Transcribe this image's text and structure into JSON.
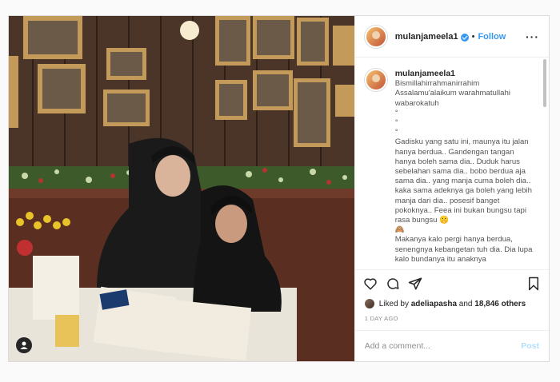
{
  "post": {
    "username": "mulanjameela1",
    "follow_label": "Follow",
    "separator": "•",
    "more_label": "···",
    "caption": "Bismillahirrahmanirrahim\nAssalamu'alaikum warahmatullahi wabarokatuh\n°\n°\n°\nGadisku yang satu ini, maunya itu jalan hanya berdua.. Gandengan tangan hanya boleh sama dia.. Duduk harus sebelahan sama dia.. bobo berdua aja sama dia.. yang manja cuma boleh dia.. kaka sama adeknya ga boleh yang lebih manja dari dia.. posesif banget pokoknya.. Feea ini bukan bungsu tapi rasa bungsu 🤫\n🙈\nMakanya kalo pergi hanya berdua, senengnya kebangetan tuh dia. Dia lupa kalo bundanya itu anaknya",
    "likes": {
      "prefix": "Liked by",
      "user": "adeliapasha",
      "connector": "and",
      "count": "18,846 others"
    },
    "time": "1 DAY AGO",
    "comment_placeholder": "Add a comment...",
    "post_label": "Post",
    "icons": {
      "heart": "heart-icon",
      "comment": "comment-icon",
      "share": "share-icon",
      "bookmark": "bookmark-icon",
      "user_tag": "user-tag-icon"
    },
    "colors": {
      "link_blue": "#3897f0",
      "post_disabled": "#b2dffc",
      "border": "#dbdbdb"
    }
  }
}
